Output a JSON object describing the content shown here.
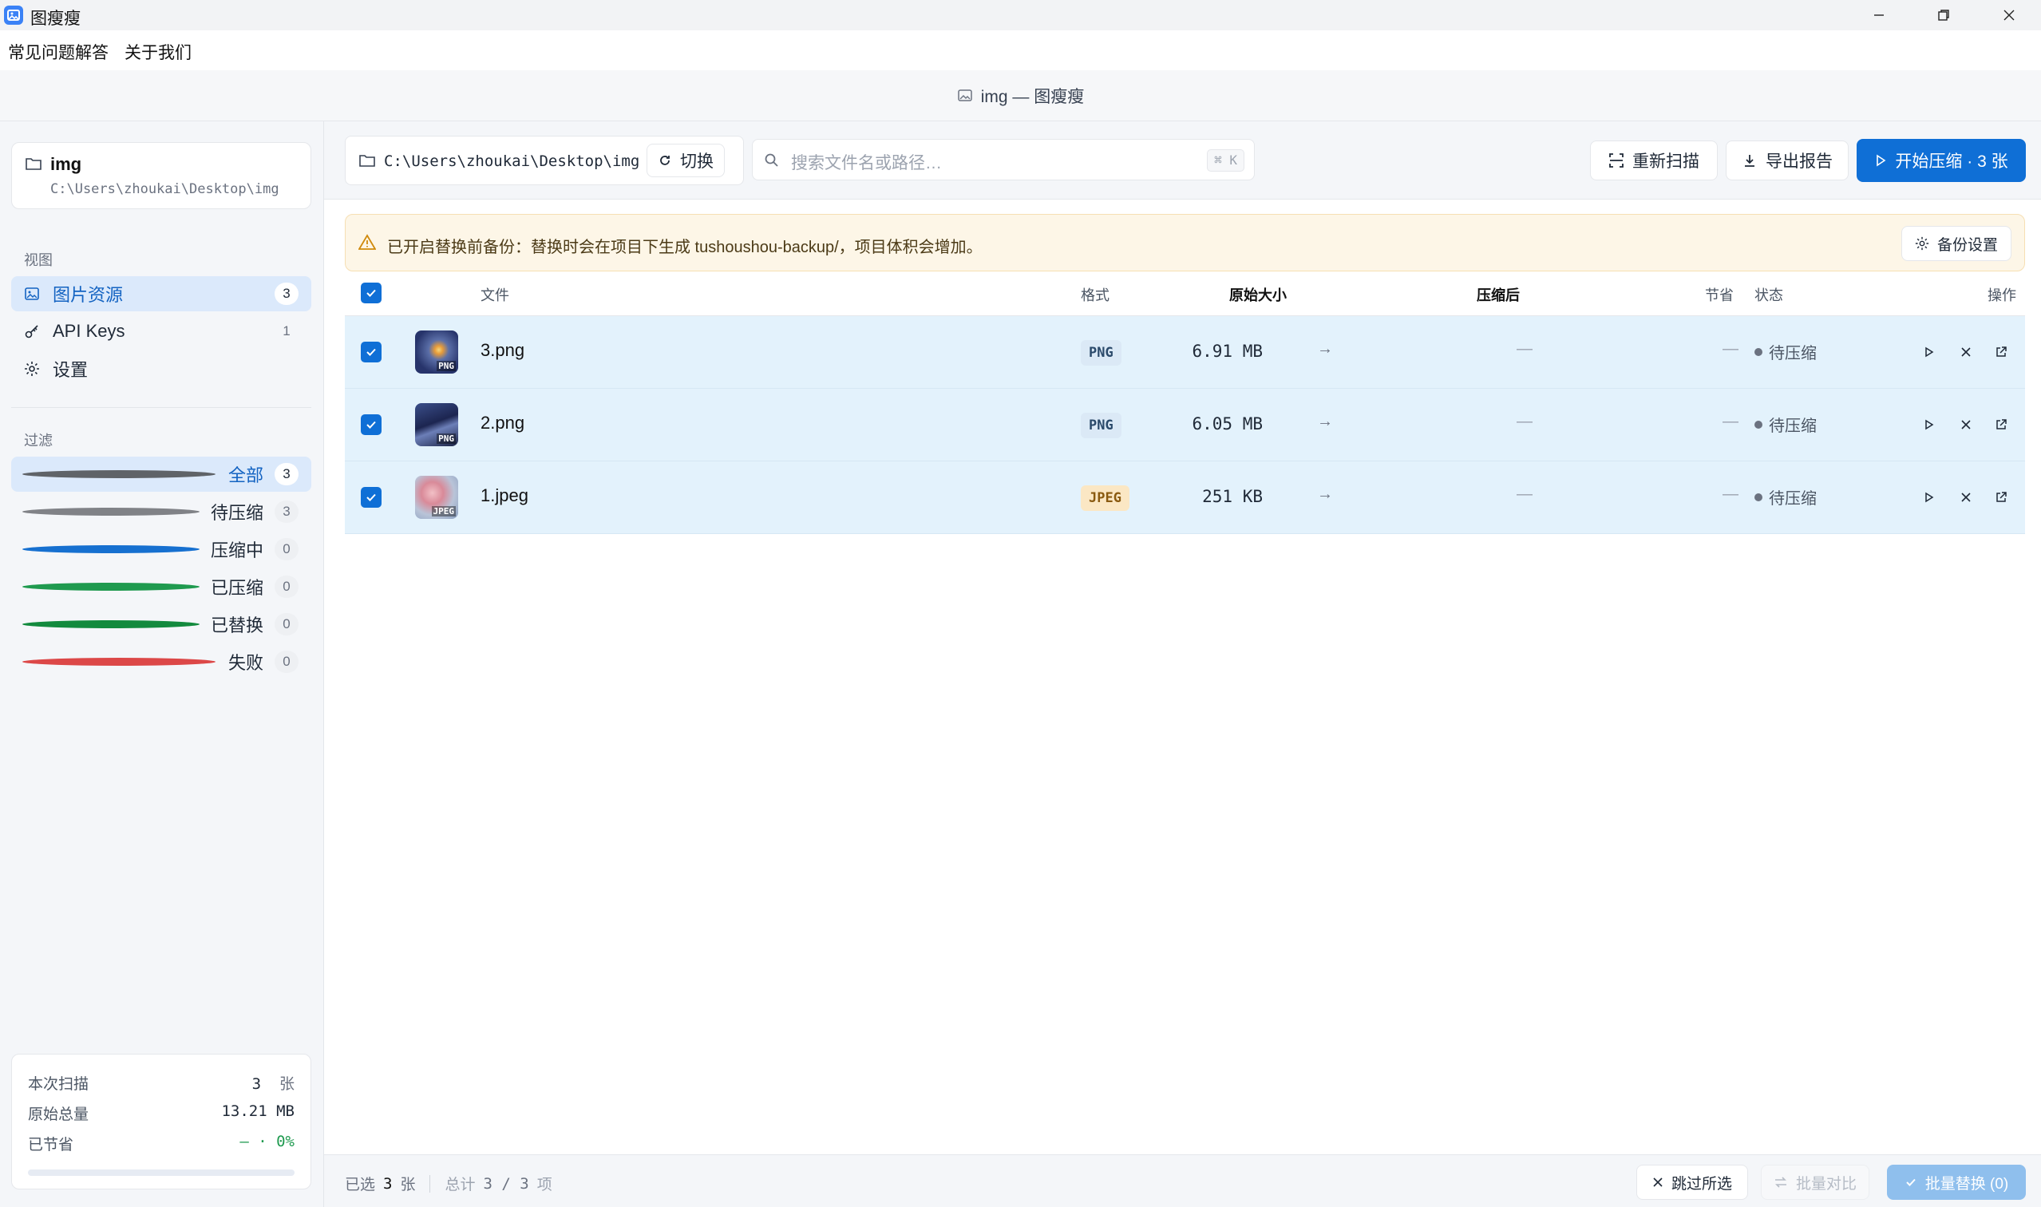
{
  "app": {
    "title": "图瘦瘦",
    "doc_title": "img — 图瘦瘦"
  },
  "menu": {
    "items": [
      "常见问题解答",
      "关于我们"
    ]
  },
  "project": {
    "name": "img",
    "path": "C:\\Users\\zhoukai\\Desktop\\img"
  },
  "sidebar": {
    "view_label": "视图",
    "nav": [
      {
        "label": "图片资源",
        "count": "3",
        "icon": "image-icon"
      },
      {
        "label": "API Keys",
        "count": "1",
        "icon": "key-icon"
      },
      {
        "label": "设置",
        "icon": "gear-icon"
      }
    ],
    "filter_label": "过滤",
    "filters": [
      {
        "label": "全部",
        "count": "3",
        "color": "#5f6368"
      },
      {
        "label": "待压缩",
        "count": "3",
        "color": "#808287"
      },
      {
        "label": "压缩中",
        "count": "0",
        "color": "#1670d0"
      },
      {
        "label": "已压缩",
        "count": "0",
        "color": "#1f9a4f"
      },
      {
        "label": "已替换",
        "count": "0",
        "color": "#138a3e"
      },
      {
        "label": "失败",
        "count": "0",
        "color": "#dc4848"
      }
    ]
  },
  "stats": {
    "scan_label": "本次扫描",
    "scan_value": "3",
    "scan_unit": "张",
    "total_label": "原始总量",
    "total_value": "13.21 MB",
    "saved_label": "已节省",
    "saved_value": "— · 0%",
    "progress": 0
  },
  "toolbar": {
    "path": "C:\\Users\\zhoukai\\Desktop\\img",
    "switch_label": "切换",
    "search_placeholder": "搜索文件名或路径…",
    "search_shortcut": "⌘ K",
    "rescan_label": "重新扫描",
    "export_label": "导出报告",
    "start_label": "开始压缩 · 3 张"
  },
  "warning": {
    "text": "已开启替换前备份：替换时会在项目下生成 tushoushou-backup/，项目体积会增加。",
    "settings_label": "备份设置"
  },
  "table": {
    "headers": {
      "file": "文件",
      "format": "格式",
      "original": "原始大小",
      "compressed": "压缩后",
      "saving": "节省",
      "status": "状态",
      "actions": "操作"
    },
    "rows": [
      {
        "name": "3.png",
        "format": "PNG",
        "size": "6.91 MB",
        "compressed": "—",
        "saving": "—",
        "status": "待压缩",
        "thumb_label": "PNG"
      },
      {
        "name": "2.png",
        "format": "PNG",
        "size": "6.05 MB",
        "compressed": "—",
        "saving": "—",
        "status": "待压缩",
        "thumb_label": "PNG"
      },
      {
        "name": "1.jpeg",
        "format": "JPEG",
        "size": "251 KB",
        "compressed": "—",
        "saving": "—",
        "status": "待压缩",
        "thumb_label": "JPEG"
      }
    ]
  },
  "footer": {
    "selected_prefix": "已选",
    "selected_count": "3",
    "selected_unit": "张",
    "total_prefix": "总计",
    "total_value": "3 / 3",
    "total_unit": "项",
    "skip_label": "跳过所选",
    "compare_label": "批量对比",
    "replace_label": "批量替换 (0)"
  }
}
